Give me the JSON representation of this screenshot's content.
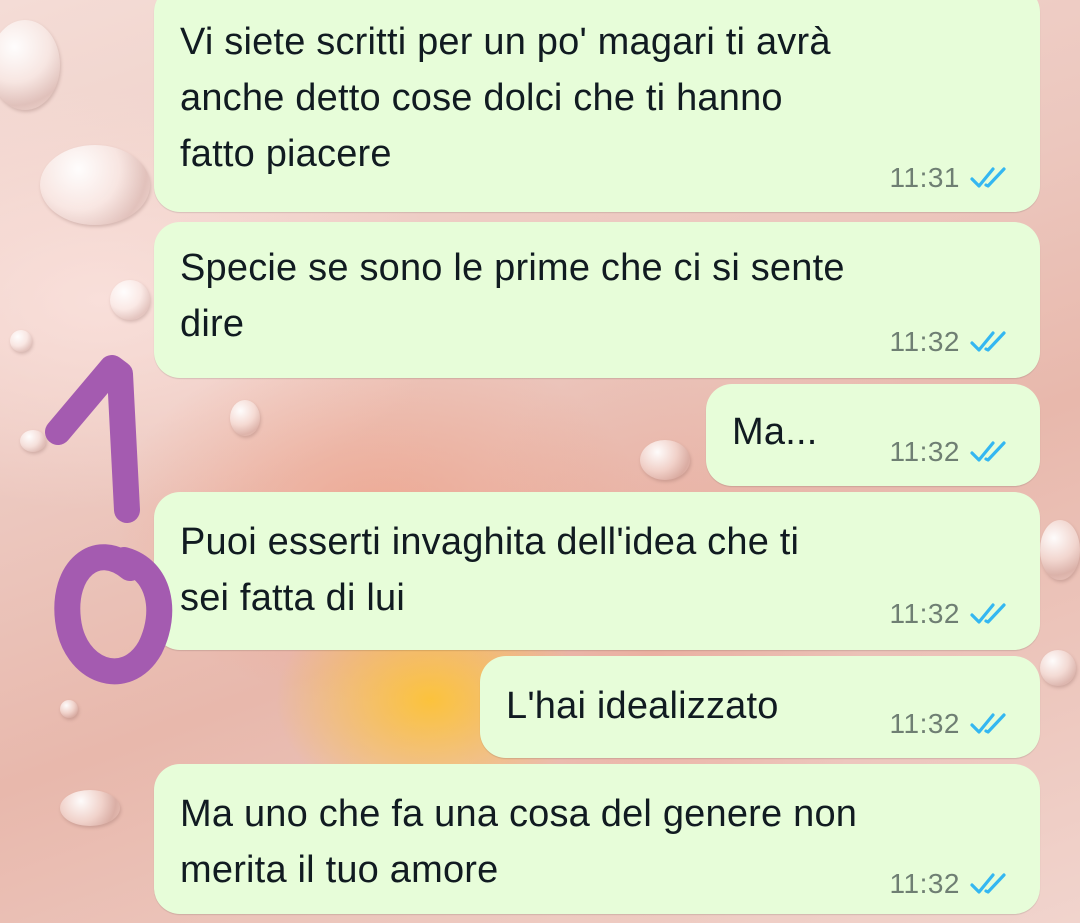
{
  "messages": [
    {
      "text": "Vi siete scritti per un po' magari ti avrà\nanche detto cose dolci che ti hanno\nfatto piacere",
      "time": "11:31",
      "status": "read-double-check-icon"
    },
    {
      "text": "Specie se sono le prime che ci si sente\ndire",
      "time": "11:32",
      "status": "read-double-check-icon"
    },
    {
      "text": "Ma...",
      "time": "11:32",
      "status": "read-double-check-icon"
    },
    {
      "text": "Puoi esserti invaghita dell'idea che ti\nsei fatta di lui",
      "time": "11:32",
      "status": "read-double-check-icon"
    },
    {
      "text": "L'hai idealizzato",
      "time": "11:32",
      "status": "read-double-check-icon"
    },
    {
      "text": "Ma uno che fa una cosa del genere non\nmerita il tuo amore",
      "time": "11:32",
      "status": "read-double-check-icon"
    }
  ],
  "colors": {
    "bubble": "#e7fdd9",
    "text": "#111b21",
    "time": "#6f7f73",
    "read_ticks": "#34b7f1",
    "annotation": "#a45bb0"
  }
}
